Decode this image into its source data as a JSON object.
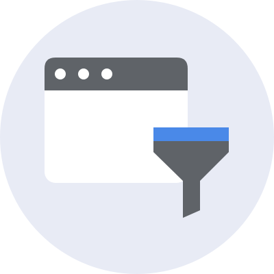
{
  "illustration": {
    "subject": "browser-window-with-filter-funnel",
    "icons": [
      "browser-window-icon",
      "filter-funnel-icon"
    ],
    "colors": {
      "background_circle": "#e8ebf5",
      "window_body": "#ffffff",
      "window_titlebar": "#5f6368",
      "window_dots": "#ffffff",
      "funnel_body": "#5f6368",
      "funnel_rim": "#4a89e8"
    },
    "window_dot_count": 3
  }
}
